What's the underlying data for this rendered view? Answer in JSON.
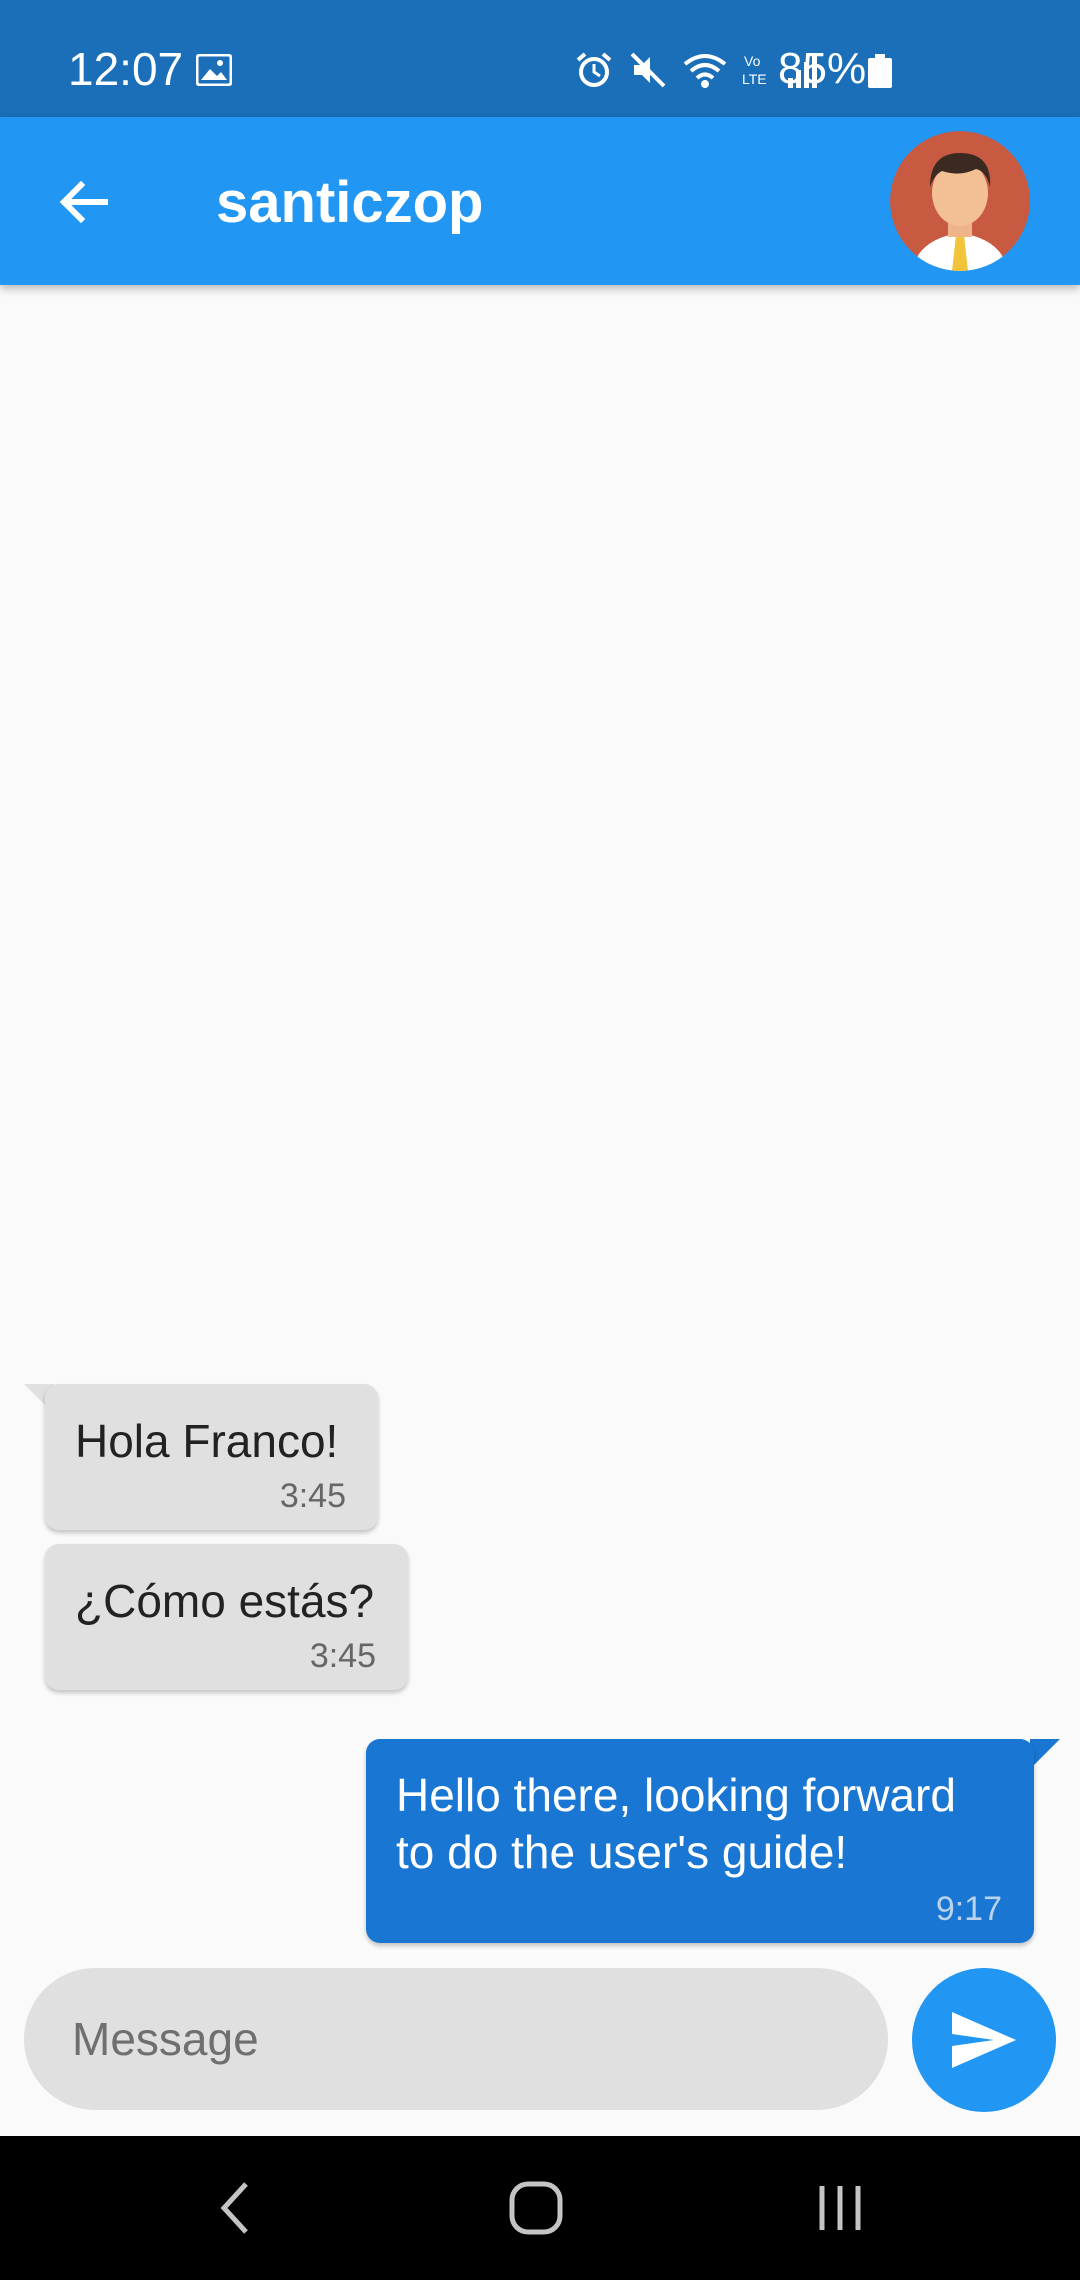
{
  "status_bar": {
    "time": "12:07",
    "battery": "85%",
    "icons": [
      "gallery-icon",
      "alarm-icon",
      "mute-icon",
      "wifi-icon",
      "volte-icon",
      "signal-icon",
      "battery-icon"
    ]
  },
  "header": {
    "title": "santiczop",
    "back_icon": "arrow-back-icon",
    "avatar": "user-avatar"
  },
  "messages": [
    {
      "direction": "incoming",
      "text": "Hola Franco!",
      "time": "3:45"
    },
    {
      "direction": "incoming",
      "text": "¿Cómo estás?",
      "time": "3:45"
    },
    {
      "direction": "outgoing",
      "text": "Hello there, looking forward to do the user's guide!",
      "time": "9:17"
    }
  ],
  "composer": {
    "placeholder": "Message",
    "send_icon": "send-icon"
  },
  "navigation": {
    "icons": [
      "nav-back-icon",
      "nav-home-icon",
      "nav-recents-icon"
    ]
  },
  "colors": {
    "status_bar": "#1a6fb8",
    "app_bar": "#2196f3",
    "outgoing_bubble": "#1976d2",
    "incoming_bubble": "#e0e0e0",
    "background": "#fafafa"
  }
}
